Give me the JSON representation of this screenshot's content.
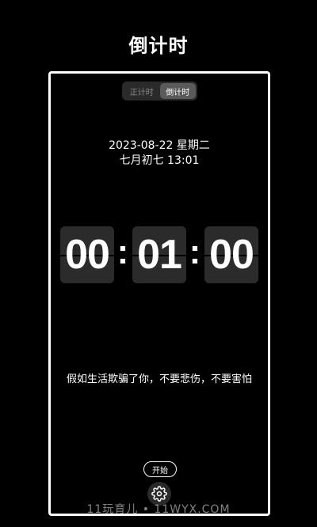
{
  "header": {
    "title": "倒计时"
  },
  "timer": {
    "tabs": [
      {
        "label": "正计时",
        "active": false
      },
      {
        "label": "倒计时",
        "active": true
      }
    ],
    "date": "2023-08-22   星期二",
    "lunar_time": "七月初七   13:01",
    "countdown": {
      "hours": "00",
      "minutes": "01",
      "seconds": "00",
      "separator": ":"
    },
    "quote": "假如生活欺骗了你，不要悲伤，不要害怕",
    "start_label": "开始",
    "settings_icon": "gear-icon"
  },
  "watermark": "11玩育儿 • 11WYX.COM",
  "colors": {
    "background": "#000000",
    "card": "#2b2b2b",
    "text": "#ffffff",
    "active_tab": "#5a5a5a"
  }
}
